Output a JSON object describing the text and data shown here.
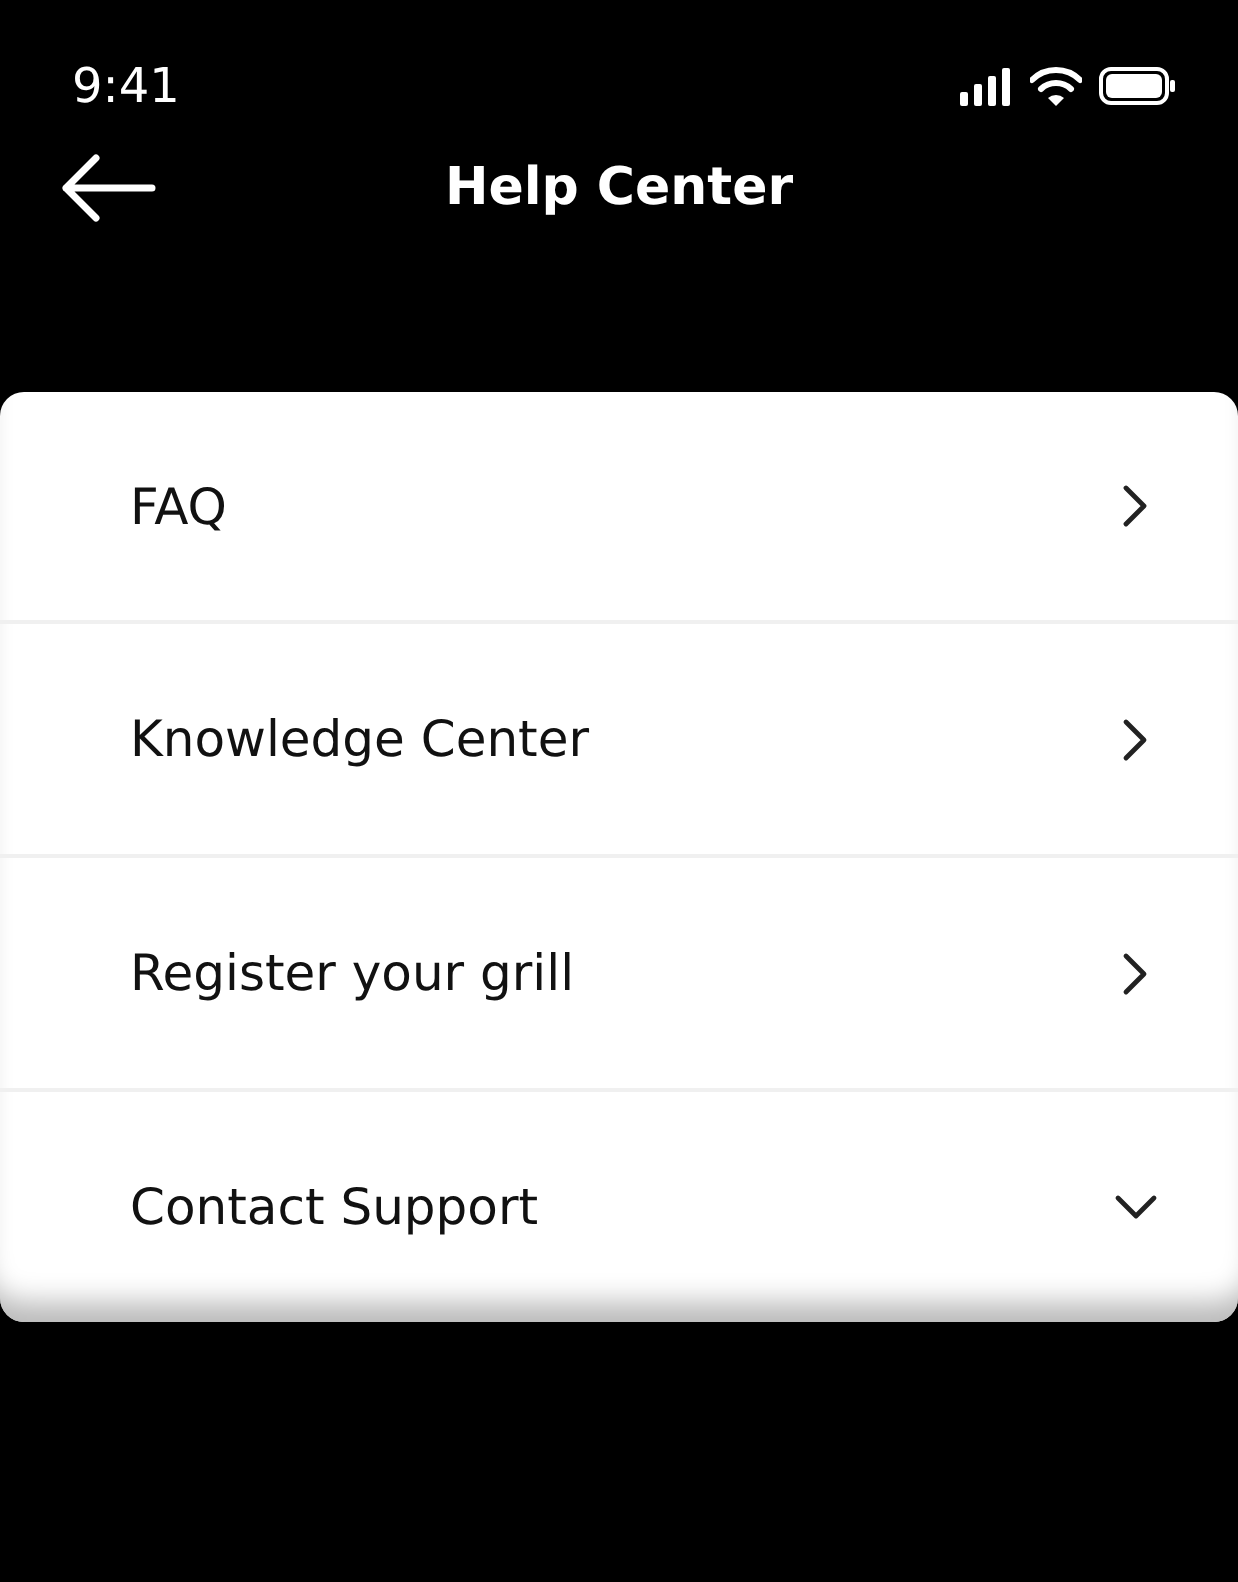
{
  "status_bar": {
    "time": "9:41"
  },
  "header": {
    "title": "Help Center"
  },
  "menu": [
    {
      "label": "FAQ",
      "kind": "link"
    },
    {
      "label": "Knowledge Center",
      "kind": "link"
    },
    {
      "label": "Register your grill",
      "kind": "link"
    },
    {
      "label": "Contact Support",
      "kind": "dropdown"
    }
  ]
}
